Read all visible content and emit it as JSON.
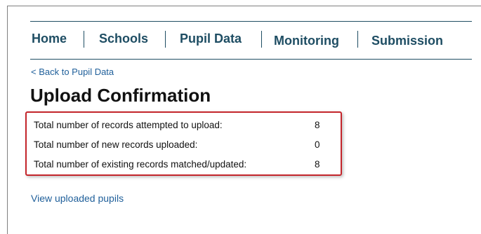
{
  "nav": {
    "items": [
      {
        "label": "Home"
      },
      {
        "label": "Schools"
      },
      {
        "label": "Pupil Data"
      },
      {
        "label": "Monitoring"
      },
      {
        "label": "Submission"
      }
    ]
  },
  "back_link": "< Back to Pupil Data",
  "page_title": "Upload Confirmation",
  "summary": {
    "rows": [
      {
        "label": "Total number of records attempted to upload:",
        "value": "8"
      },
      {
        "label": "Total number of new records uploaded:",
        "value": "0"
      },
      {
        "label": "Total number of existing records matched/updated:",
        "value": "8"
      }
    ],
    "highlight_color": "#c4252b"
  },
  "view_link": "View uploaded pupils",
  "colors": {
    "nav_text": "#1e4d63",
    "link": "#1f5f9a"
  }
}
